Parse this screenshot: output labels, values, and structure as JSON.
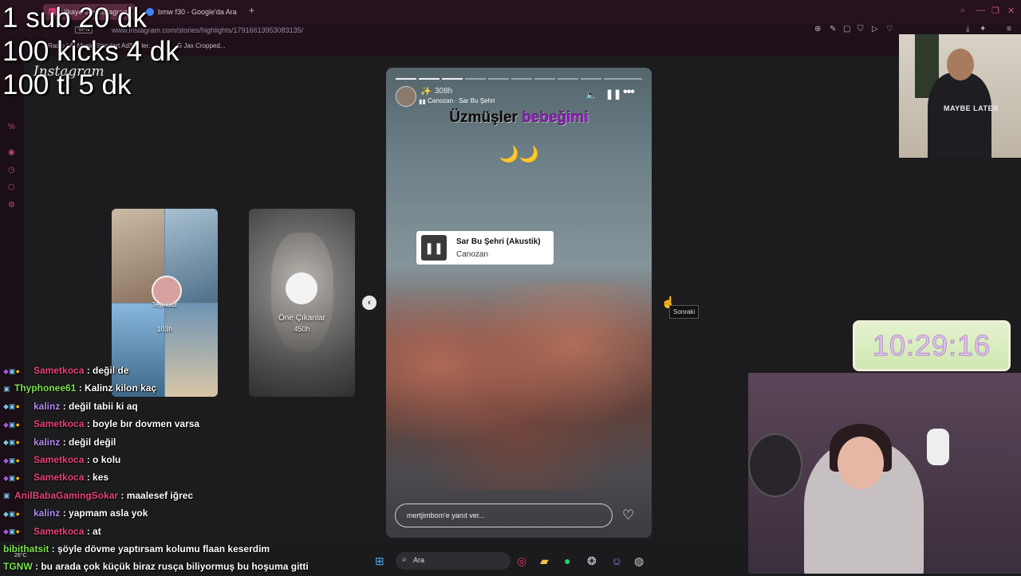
{
  "browser": {
    "tabs": [
      {
        "label": "Hikayeler • Instagram",
        "active": true
      },
      {
        "label": "bmw f30 - Google'da Ara",
        "active": false
      }
    ],
    "new_tab": "+",
    "vpn": "VPN",
    "url": "www.instagram.com/stories/highlights/17916613953083135/",
    "bookmarks": [
      "Radio | AI Music",
      "Standart Ad365 ler...",
      "G Jax Cropped..."
    ]
  },
  "overlay": {
    "goals": [
      "1 sub 20 dk",
      "100 kicks 4 dk",
      "100 tl 5 dk"
    ],
    "clock": "10:29:16",
    "shirt_text": "MAYBE LATER"
  },
  "instagram": {
    "logo": "Instagram",
    "side_cards": [
      {
        "name": "Teşekkür",
        "time": "103h"
      },
      {
        "name": "Öne Çıkanlar",
        "time": "450h"
      }
    ],
    "story": {
      "time": "308h",
      "music": "Canozan · Sar Bu Şehri",
      "caption_a": "Üzmüşler",
      "caption_b": "bebeğimi",
      "moons": "🌙🌙",
      "sticker_title": "Sar Bu Şehri (Akustik)",
      "sticker_artist": "Canozan",
      "reply_placeholder": "mertjimbom'e yanıt ver..."
    },
    "next_tooltip": "Sonraki"
  },
  "chat": [
    {
      "user": "Sametkoca",
      "color": "#e8457a",
      "badges": "vip",
      "text": "değil de"
    },
    {
      "user": "Thyphonee61",
      "color": "#7fe34f",
      "badges": "plain",
      "text": "Kalinz kilon kaç"
    },
    {
      "user": "kalinz",
      "color": "#b58cf0",
      "badges": "sub",
      "text": "değil tabii ki aq"
    },
    {
      "user": "Sametkoca",
      "color": "#e8457a",
      "badges": "vip",
      "text": "boyle bır dovmen varsa"
    },
    {
      "user": "kalinz",
      "color": "#b58cf0",
      "badges": "sub",
      "text": "değil değil"
    },
    {
      "user": "Sametkoca",
      "color": "#e8457a",
      "badges": "vip",
      "text": "o kolu"
    },
    {
      "user": "Sametkoca",
      "color": "#e8457a",
      "badges": "vip",
      "text": "kes"
    },
    {
      "user": "AnilBabaGamingSokar",
      "color": "#e8457a",
      "badges": "plain",
      "text": "maalesef iğrec"
    },
    {
      "user": "kalinz",
      "color": "#b58cf0",
      "badges": "sub",
      "text": "yapmam asla yok"
    },
    {
      "user": "Sametkoca",
      "color": "#e8457a",
      "badges": "vip",
      "text": "at"
    },
    {
      "user": "bibithatsit",
      "color": "#7fe34f",
      "badges": "none",
      "text": "şöyle dövme yaptırsam kolumu flaan keserdim"
    },
    {
      "user": "TGNW",
      "color": "#7fe34f",
      "badges": "none",
      "text": "bu arada çok küçük biraz rusça biliyormuş bu hoşuma gitti"
    }
  ],
  "taskbar": {
    "search": "Ara",
    "weather": "26°C"
  }
}
